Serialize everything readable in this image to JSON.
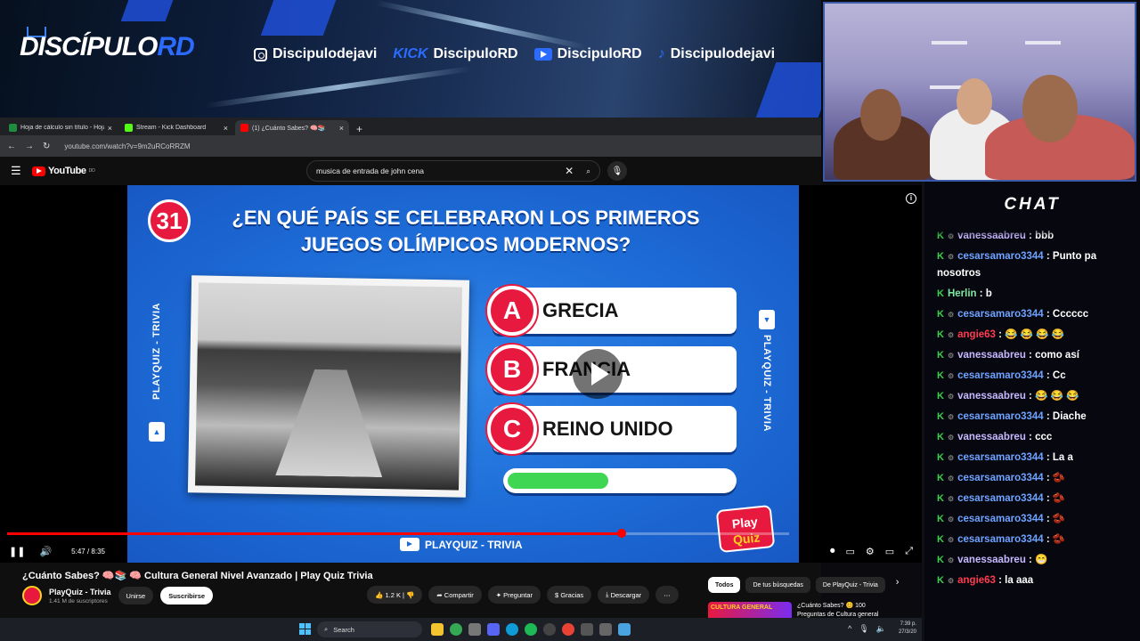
{
  "banner": {
    "logo_main": "DISCÍPULO",
    "logo_accent": "RD",
    "socials": [
      {
        "icon": "instagram-icon",
        "handle": "Discipulodejavi"
      },
      {
        "icon": "kick-icon",
        "brand": "KICK",
        "handle": "DiscipuloRD"
      },
      {
        "icon": "youtube-icon",
        "handle": "DiscipuloRD"
      },
      {
        "icon": "tiktok-icon",
        "handle": "Discipulodejavi"
      }
    ]
  },
  "browser": {
    "tabs": [
      {
        "label": "Hoja de cálculo sin título - Hoja",
        "color": "#1e8e3e",
        "active": false
      },
      {
        "label": "Stream - Kick Dashboard",
        "color": "#53fc18",
        "active": false
      },
      {
        "label": "(1) ¿Cuánto Sabes? 🧠📚",
        "color": "#ff0000",
        "active": true
      }
    ],
    "new_tab": "+",
    "url": "youtube.com/watch?v=9m2uRCoRRZM"
  },
  "youtube": {
    "logo": "YouTube",
    "region": "DO",
    "search_query": "musica de entrada de john cena"
  },
  "video": {
    "question_number": "31",
    "question": "¿EN QUÉ PAÍS SE CELEBRARON LOS PRIMEROS JUEGOS OLÍMPICOS MODERNOS?",
    "answers": [
      {
        "letter": "A",
        "text": "GRECIA"
      },
      {
        "letter": "B",
        "text": "FRANCIA"
      },
      {
        "letter": "C",
        "text": "REINO UNIDO"
      }
    ],
    "timer_fraction": 0.45,
    "side_label": "PLAYQUIZ - TRIVIA",
    "footer_label": "PLAYQUIZ - TRIVIA",
    "logo_top": "Play",
    "logo_bottom": "Quiz",
    "time_current": "5:47",
    "time_total": "8:35",
    "played_fraction": 0.786
  },
  "below": {
    "title": "¿Cuánto Sabes? 🧠📚 🧠 Cultura General Nivel Avanzado | Play Quiz Trivia",
    "channel": "PlayQuiz - Trivia",
    "subscribers": "1.41 M de suscriptores",
    "join": "Unirse",
    "subscribe": "Suscribirse",
    "likes": "1.2 K",
    "share": "Compartir",
    "ask": "Preguntar",
    "thanks": "Gracias",
    "download": "Descargar",
    "chips": [
      "Todos",
      "De tus búsquedas",
      "De PlayQuiz - Trivia"
    ],
    "suggestion_thumb": "CULTURA GENERAL",
    "suggestion_title": "¿Cuánto Sabes? 😊 100 Preguntas de Cultura general"
  },
  "taskbar": {
    "search": "Search",
    "time": "7:39 p.",
    "date": "27/3/20"
  },
  "chat": {
    "title": "CHAT",
    "messages": [
      {
        "user": "vanessaabreu",
        "text": "bbb",
        "color": "lav"
      },
      {
        "user": "cesarsamaro3344",
        "text": "Punto pa nosotros",
        "color": "blue",
        "wrap": true
      },
      {
        "user": "Herlin",
        "text": "b",
        "color": "green",
        "nobadge": true
      },
      {
        "user": "cesarsamaro3344",
        "text": "Cccccc",
        "color": "blue"
      },
      {
        "user": "angie63",
        "text": "😂 😂 😂 😂",
        "color": "red"
      },
      {
        "user": "vanessaabreu",
        "text": "como así",
        "color": "lav"
      },
      {
        "user": "cesarsamaro3344",
        "text": "Cc",
        "color": "blue"
      },
      {
        "user": "vanessaabreu",
        "text": "😂 😂 😂",
        "color": "lav"
      },
      {
        "user": "cesarsamaro3344",
        "text": "Diache",
        "color": "blue"
      },
      {
        "user": "vanessaabreu",
        "text": "ccc",
        "color": "lav"
      },
      {
        "user": "cesarsamaro3344",
        "text": "La a",
        "color": "blue"
      },
      {
        "user": "cesarsamaro3344",
        "text": "🫘",
        "color": "blue"
      },
      {
        "user": "cesarsamaro3344",
        "text": "🫘",
        "color": "blue"
      },
      {
        "user": "cesarsamaro3344",
        "text": "🫘",
        "color": "blue"
      },
      {
        "user": "cesarsamaro3344",
        "text": "🫘",
        "color": "blue"
      },
      {
        "user": "vanessaabreu",
        "text": "😁",
        "color": "lav"
      },
      {
        "user": "angie63",
        "text": "la aaa",
        "color": "red"
      }
    ]
  }
}
